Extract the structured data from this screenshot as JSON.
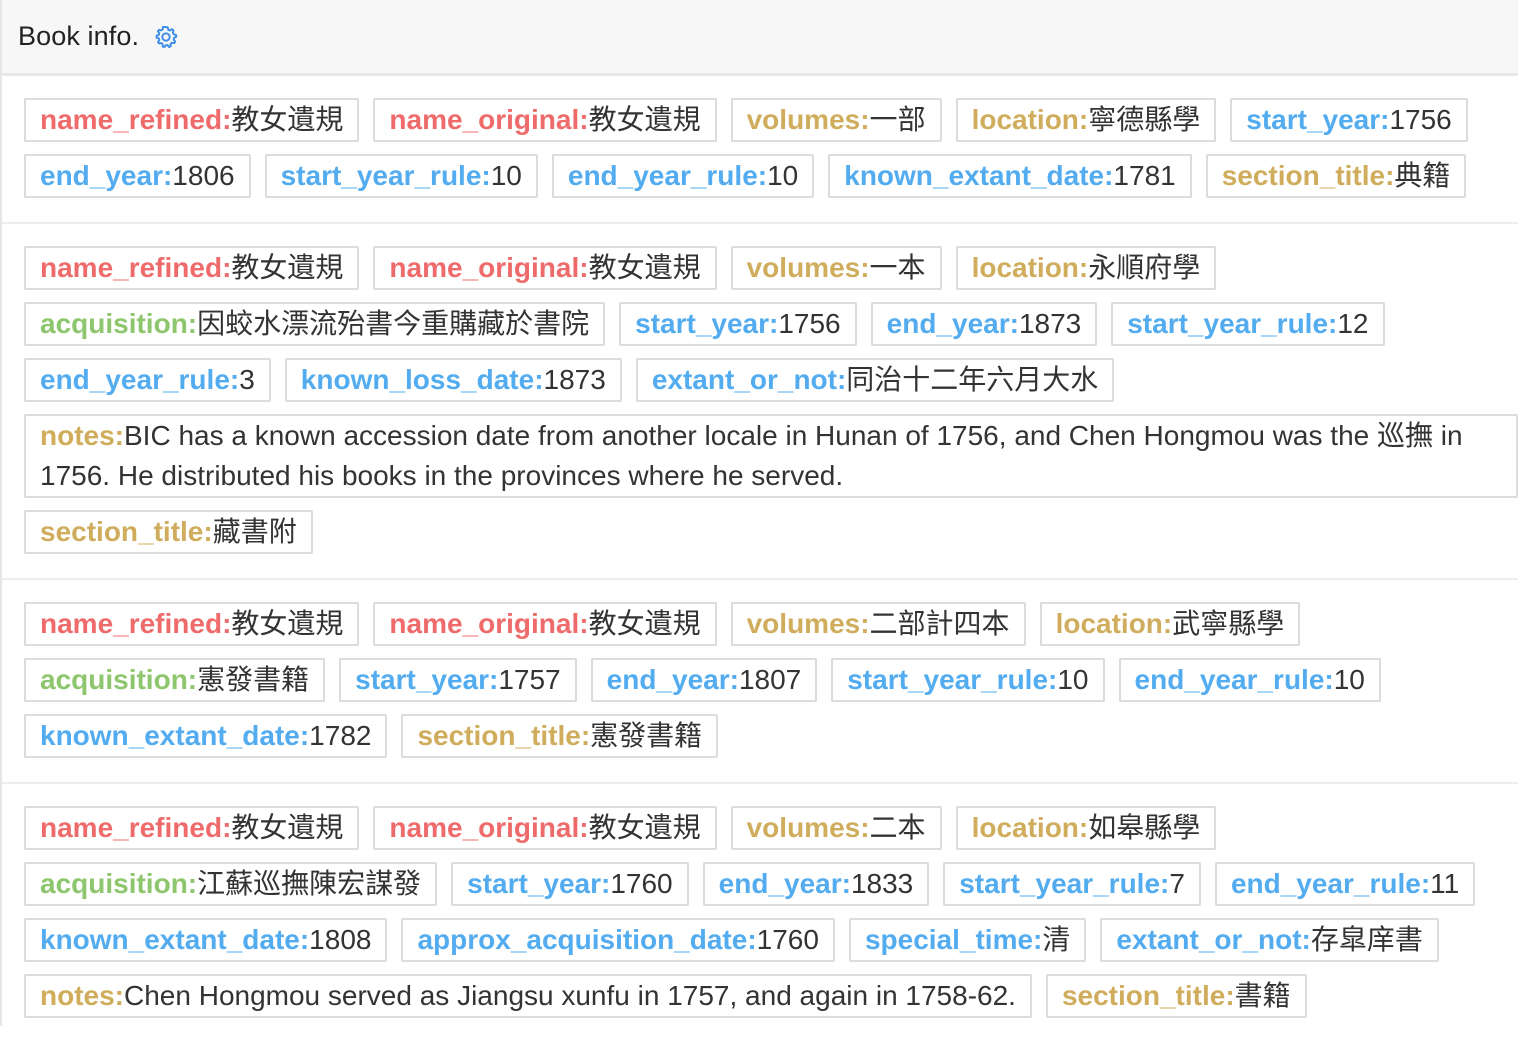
{
  "header": {
    "title": "Book info.",
    "icon": "gear-icon",
    "icon_color": "#3d8ee8"
  },
  "colors": {
    "red": "#ef6b6b",
    "gold": "#cfad5c",
    "blue": "#52acef",
    "green": "#8dc66c"
  },
  "records": [
    {
      "fields": [
        {
          "key": "name_refined:",
          "value": "教女遺規",
          "color": "red"
        },
        {
          "key": "name_original:",
          "value": "教女遺規",
          "color": "red"
        },
        {
          "key": "volumes:",
          "value": "一部",
          "color": "gold"
        },
        {
          "key": "location:",
          "value": "寧德縣學",
          "color": "gold"
        },
        {
          "key": "start_year:",
          "value": "1756",
          "color": "blue"
        },
        {
          "key": "end_year:",
          "value": "1806",
          "color": "blue"
        },
        {
          "key": "start_year_rule:",
          "value": "10",
          "color": "blue"
        },
        {
          "key": "end_year_rule:",
          "value": "10",
          "color": "blue"
        },
        {
          "key": "known_extant_date:",
          "value": "1781",
          "color": "blue"
        },
        {
          "key": "section_title:",
          "value": "典籍",
          "color": "gold"
        }
      ]
    },
    {
      "fields": [
        {
          "key": "name_refined:",
          "value": "教女遺規",
          "color": "red"
        },
        {
          "key": "name_original:",
          "value": "教女遺規",
          "color": "red"
        },
        {
          "key": "volumes:",
          "value": "一本",
          "color": "gold"
        },
        {
          "key": "location:",
          "value": "永順府學",
          "color": "gold"
        },
        {
          "key": "acquisition:",
          "value": "因蛟水漂流殆書今重購藏於書院",
          "color": "green"
        },
        {
          "key": "start_year:",
          "value": "1756",
          "color": "blue"
        },
        {
          "key": "end_year:",
          "value": "1873",
          "color": "blue"
        },
        {
          "key": "start_year_rule:",
          "value": "12",
          "color": "blue"
        },
        {
          "key": "end_year_rule:",
          "value": "3",
          "color": "blue"
        },
        {
          "key": "known_loss_date:",
          "value": "1873",
          "color": "blue"
        },
        {
          "key": "extant_or_not:",
          "value": "同治十二年六月大水",
          "color": "blue"
        },
        {
          "key": "notes:",
          "value": "BIC has a known accession date from another locale in Hunan of 1756, and Chen Hongmou was the 巡撫 in 1756. He distributed his books in the provinces where he served.",
          "color": "gold",
          "wide": true
        },
        {
          "key": "section_title:",
          "value": "藏書附",
          "color": "gold"
        }
      ]
    },
    {
      "fields": [
        {
          "key": "name_refined:",
          "value": "教女遺規",
          "color": "red"
        },
        {
          "key": "name_original:",
          "value": "教女遺規",
          "color": "red"
        },
        {
          "key": "volumes:",
          "value": "二部計四本",
          "color": "gold"
        },
        {
          "key": "location:",
          "value": "武寧縣學",
          "color": "gold"
        },
        {
          "key": "acquisition:",
          "value": "憲發書籍",
          "color": "green"
        },
        {
          "key": "start_year:",
          "value": "1757",
          "color": "blue"
        },
        {
          "key": "end_year:",
          "value": "1807",
          "color": "blue"
        },
        {
          "key": "start_year_rule:",
          "value": "10",
          "color": "blue"
        },
        {
          "key": "end_year_rule:",
          "value": "10",
          "color": "blue"
        },
        {
          "key": "known_extant_date:",
          "value": "1782",
          "color": "blue"
        },
        {
          "key": "section_title:",
          "value": "憲發書籍",
          "color": "gold"
        }
      ]
    },
    {
      "fields": [
        {
          "key": "name_refined:",
          "value": "教女遺規",
          "color": "red"
        },
        {
          "key": "name_original:",
          "value": "教女遺規",
          "color": "red"
        },
        {
          "key": "volumes:",
          "value": "二本",
          "color": "gold"
        },
        {
          "key": "location:",
          "value": "如皋縣學",
          "color": "gold"
        },
        {
          "key": "acquisition:",
          "value": "江蘇巡撫陳宏謀發",
          "color": "green"
        },
        {
          "key": "start_year:",
          "value": "1760",
          "color": "blue"
        },
        {
          "key": "end_year:",
          "value": "1833",
          "color": "blue"
        },
        {
          "key": "start_year_rule:",
          "value": "7",
          "color": "blue"
        },
        {
          "key": "end_year_rule:",
          "value": "11",
          "color": "blue"
        },
        {
          "key": "known_extant_date:",
          "value": "1808",
          "color": "blue"
        },
        {
          "key": "approx_acquisition_date:",
          "value": "1760",
          "color": "blue"
        },
        {
          "key": "special_time:",
          "value": "清",
          "color": "blue"
        },
        {
          "key": "extant_or_not:",
          "value": "存皐庠書",
          "color": "blue"
        },
        {
          "key": "notes:",
          "value": "Chen Hongmou served as Jiangsu xunfu in 1757, and again in 1758-62.",
          "color": "gold"
        },
        {
          "key": "section_title:",
          "value": "書籍",
          "color": "gold"
        }
      ]
    }
  ]
}
